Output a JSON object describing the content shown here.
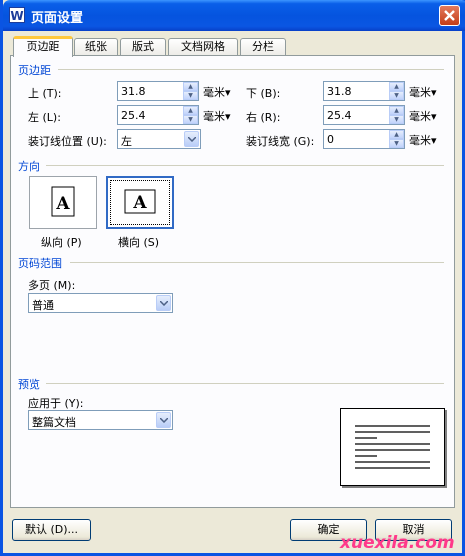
{
  "window": {
    "title": "页面设置",
    "app_icon_letter": "W"
  },
  "tabs": [
    {
      "label": "页边距",
      "active": true
    },
    {
      "label": "纸张"
    },
    {
      "label": "版式"
    },
    {
      "label": "文档网格"
    },
    {
      "label": "分栏"
    }
  ],
  "margins": {
    "section_title": "页边距",
    "top": {
      "label": "上 (T):",
      "value": "31.8",
      "unit": "毫米"
    },
    "bottom": {
      "label": "下 (B):",
      "value": "31.8",
      "unit": "毫米"
    },
    "left": {
      "label": "左 (L):",
      "value": "25.4",
      "unit": "毫米"
    },
    "right": {
      "label": "右 (R):",
      "value": "25.4",
      "unit": "毫米"
    },
    "gutter_pos": {
      "label": "装订线位置 (U):",
      "value": "左"
    },
    "gutter": {
      "label": "装订线宽 (G):",
      "value": "0",
      "unit": "毫米"
    }
  },
  "orientation": {
    "section_title": "方向",
    "portrait": {
      "label": "纵向 (P)",
      "glyph": "A"
    },
    "landscape": {
      "label": "横向 (S)",
      "glyph": "A",
      "selected": true
    }
  },
  "pages": {
    "section_title": "页码范围",
    "multi_label": "多页 (M):",
    "multi_value": "普通"
  },
  "preview": {
    "section_title": "预览",
    "apply_label": "应用于 (Y):",
    "apply_value": "整篇文档"
  },
  "buttons": {
    "default": "默认 (D)...",
    "ok": "确定",
    "cancel": "取消"
  },
  "watermark": "xuexila.com",
  "colors": {
    "title_bar": "#0554df",
    "section": "#0046d5",
    "tab_highlight": "#ffc83c",
    "watermark": "#ff3a8a"
  }
}
